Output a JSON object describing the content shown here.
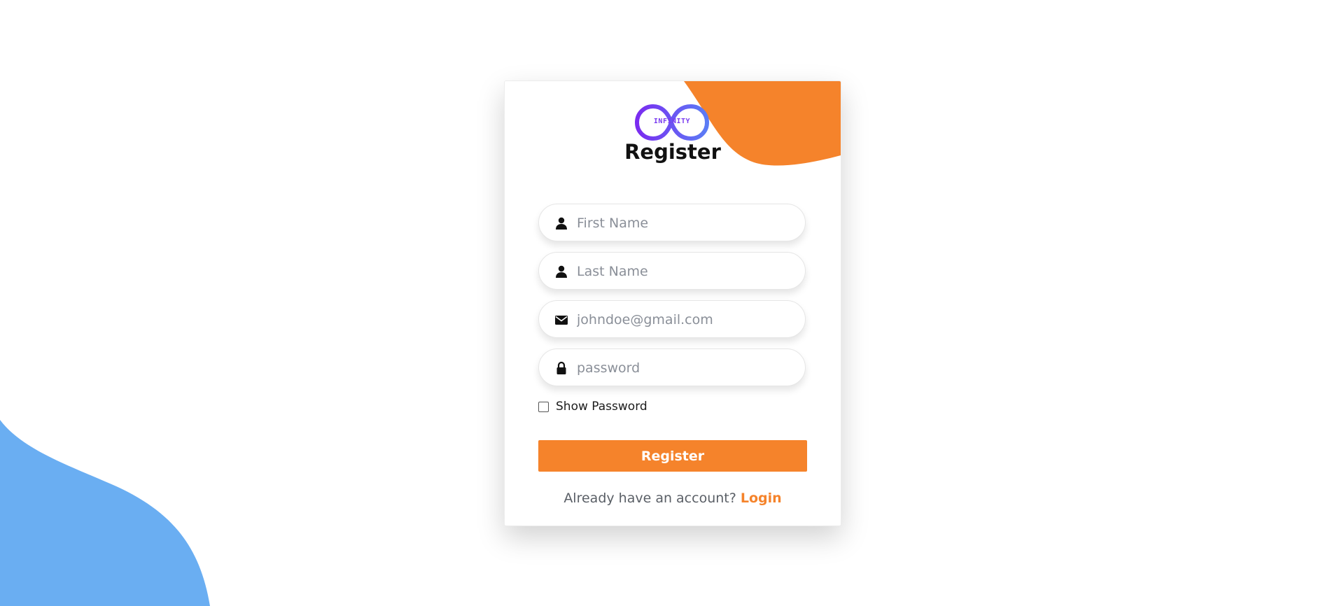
{
  "brand": {
    "logo_text": "INFINITY",
    "accent_color": "#f5832b",
    "logo_gradient": [
      "#7a2cf0",
      "#5b7cf5"
    ],
    "background_shape_color": "#6aaef2"
  },
  "form": {
    "title": "Register",
    "fields": {
      "first_name": {
        "placeholder": "First Name",
        "value": "",
        "icon": "user-icon"
      },
      "last_name": {
        "placeholder": "Last Name",
        "value": "",
        "icon": "user-icon"
      },
      "email": {
        "placeholder": "johndoe@gmail.com",
        "value": "",
        "icon": "envelope-icon"
      },
      "password": {
        "placeholder": "password",
        "value": "",
        "icon": "lock-icon"
      }
    },
    "show_password": {
      "label": "Show Password",
      "checked": false
    },
    "submit_label": "Register",
    "footer": {
      "prompt": "Already have an account?",
      "login_label": "Login"
    }
  }
}
